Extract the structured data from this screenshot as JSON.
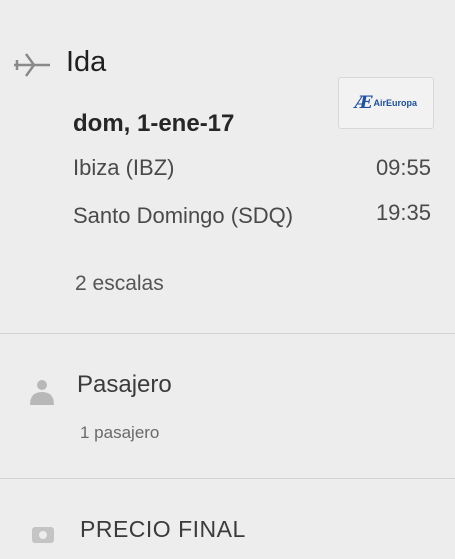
{
  "outbound": {
    "title": "Ida",
    "date": "dom, 1-ene-17",
    "origin": "Ibiza (IBZ)",
    "departure_time": "09:55",
    "destination": "Santo Domingo (SDQ)",
    "arrival_time": "19:35",
    "stops": "2 escalas",
    "airline": {
      "logo_mark": "Æ",
      "logo_text": "AirEuropa",
      "brand_color": "#1d4fa3"
    }
  },
  "passengers": {
    "title": "Pasajero",
    "count": "1 pasajero"
  },
  "price": {
    "title": "PRECIO FINAL"
  },
  "icons": {
    "outbound": "plane-icon",
    "passengers": "person-icon",
    "price": "price-icon"
  }
}
